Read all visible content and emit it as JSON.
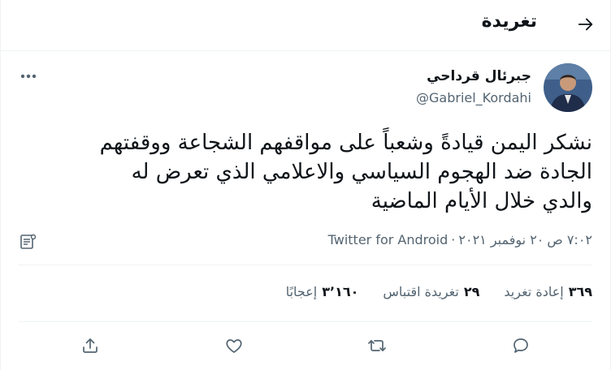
{
  "header": {
    "title": "تغريدة"
  },
  "tweet": {
    "author_name": "جبرئال قرداحي",
    "author_handle": "@Gabriel_Kordahi",
    "text_lines": [
      "نشكر اليمن قيادةً وشعباً على مواقفهم الشجاعة ووقفتهم",
      "الجادة ضد الهجوم السياسي والاعلامي الذي تعرض له",
      "والدي خلال الأيام الماضية"
    ],
    "time": "٧:٠٢ ص",
    "date": "٢٠ نوفمبر ٢٠٢١",
    "separator": "·",
    "source": "Twitter for Android"
  },
  "stats": {
    "retweets": {
      "count": "٣٦٩",
      "label": "إعادة تغريد"
    },
    "quotes": {
      "count": "٢٩",
      "label": "تغريدة اقتباس"
    },
    "likes": {
      "count": "٣٬١٦٠",
      "label": "إعجابًا"
    }
  },
  "icons": {
    "back": "arrow-right-icon",
    "more": "more-dots-icon",
    "analytics": "analytics-icon",
    "reply": "reply-icon",
    "retweet": "retweet-icon",
    "like": "heart-icon",
    "share": "share-icon"
  },
  "colors": {
    "text": "#0f1419",
    "secondary": "#536471",
    "border": "#eff3f4"
  }
}
